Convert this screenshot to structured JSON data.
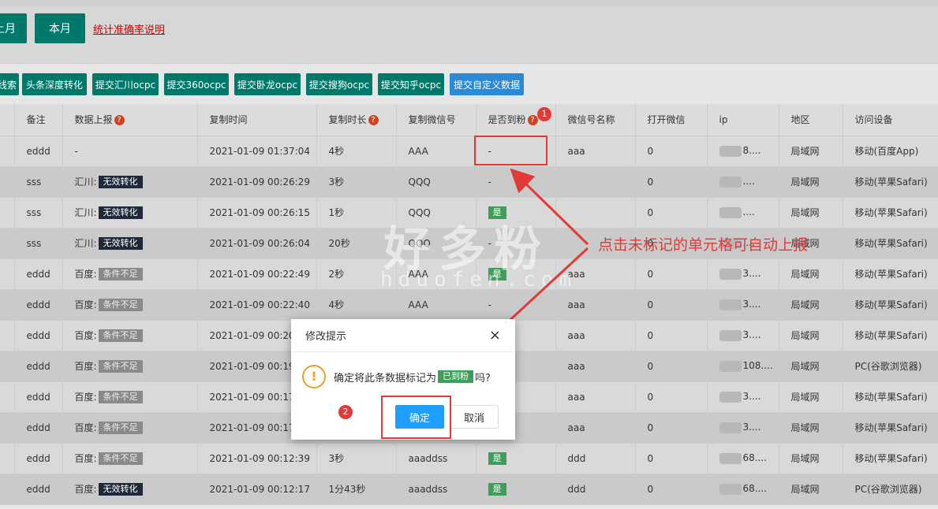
{
  "top": {
    "buttons": [
      "上月",
      "本月"
    ],
    "link": "统计准确率说明"
  },
  "toolbar": {
    "buttons": [
      "线索",
      "头条深度转化",
      "提交汇川ocpc",
      "提交360ocpc",
      "提交卧龙ocpc",
      "提交搜狗ocpc",
      "提交知乎ocpc",
      "提交自定义数据"
    ]
  },
  "table": {
    "columns": [
      "备注",
      "数据上报",
      "复制时间",
      "复制时长",
      "复制微信号",
      "是否到粉",
      "微信号名称",
      "打开微信",
      "ip",
      "地区",
      "访问设备"
    ],
    "help_mark": "?",
    "rows": [
      {
        "note": "eddd",
        "report_prefix": "-",
        "report_tag": "",
        "copy_time": "2021-01-09 01:37:04",
        "duration": "4秒",
        "wechat": "AAA",
        "fan": "-",
        "wx_name": "aaa",
        "open": "0",
        "ip": "8....",
        "region": "局域网",
        "device": "移动(百度App)"
      },
      {
        "note": "sss",
        "report_prefix": "汇川:",
        "report_tag": "无效转化",
        "copy_time": "2021-01-09 00:26:29",
        "duration": "3秒",
        "wechat": "QQQ",
        "fan": "-",
        "wx_name": "",
        "open": "0",
        "ip": "....",
        "region": "局域网",
        "device": "移动(苹果Safari)"
      },
      {
        "note": "sss",
        "report_prefix": "汇川:",
        "report_tag": "无效转化",
        "copy_time": "2021-01-09 00:26:15",
        "duration": "1秒",
        "wechat": "QQQ",
        "fan": "是",
        "wx_name": "",
        "open": "0",
        "ip": "....",
        "region": "局域网",
        "device": "移动(苹果Safari)"
      },
      {
        "note": "sss",
        "report_prefix": "汇川:",
        "report_tag": "无效转化",
        "copy_time": "2021-01-09 00:26:04",
        "duration": "20秒",
        "wechat": "QQQ",
        "fan": "-",
        "wx_name": "",
        "open": "0",
        "ip": "....",
        "region": "局域网",
        "device": "移动(苹果Safari)"
      },
      {
        "note": "eddd",
        "report_prefix": "百度:",
        "report_tag": "条件不足",
        "copy_time": "2021-01-09 00:22:49",
        "duration": "2秒",
        "wechat": "AAA",
        "fan": "是",
        "wx_name": "aaa",
        "open": "0",
        "ip": "3....",
        "region": "局域网",
        "device": "移动(苹果Safari)"
      },
      {
        "note": "eddd",
        "report_prefix": "百度:",
        "report_tag": "条件不足",
        "copy_time": "2021-01-09 00:22:40",
        "duration": "4秒",
        "wechat": "AAA",
        "fan": "-",
        "wx_name": "aaa",
        "open": "0",
        "ip": "3....",
        "region": "局域网",
        "device": "移动(苹果Safari)"
      },
      {
        "note": "eddd",
        "report_prefix": "百度:",
        "report_tag": "条件不足",
        "copy_time": "2021-01-09 00:20:2",
        "duration": "",
        "wechat": "",
        "fan": "",
        "wx_name": "aaa",
        "open": "0",
        "ip": "3....",
        "region": "局域网",
        "device": "移动(苹果Safari)"
      },
      {
        "note": "eddd",
        "report_prefix": "百度:",
        "report_tag": "条件不足",
        "copy_time": "2021-01-09 00:19:5",
        "duration": "",
        "wechat": "",
        "fan": "",
        "wx_name": "aaa",
        "open": "0",
        "ip": "108....",
        "region": "局域网",
        "device": "PC(谷歌浏览器)"
      },
      {
        "note": "eddd",
        "report_prefix": "百度:",
        "report_tag": "条件不足",
        "copy_time": "2021-01-09 00:17:1",
        "duration": "",
        "wechat": "",
        "fan": "",
        "wx_name": "aaa",
        "open": "0",
        "ip": "3....",
        "region": "局域网",
        "device": "移动(苹果Safari)"
      },
      {
        "note": "eddd",
        "report_prefix": "百度:",
        "report_tag": "条件不足",
        "copy_time": "2021-01-09 00:17:0",
        "duration": "",
        "wechat": "",
        "fan": "",
        "wx_name": "aaa",
        "open": "0",
        "ip": "3....",
        "region": "局域网",
        "device": "移动(苹果Safari)"
      },
      {
        "note": "eddd",
        "report_prefix": "百度:",
        "report_tag": "条件不足",
        "copy_time": "2021-01-09 00:12:39",
        "duration": "3秒",
        "wechat": "aaaddss",
        "fan": "是",
        "wx_name": "ddd",
        "open": "0",
        "ip": "68....",
        "region": "局域网",
        "device": "移动(苹果Safari)"
      },
      {
        "note": "eddd",
        "report_prefix": "百度:",
        "report_tag": "无效转化",
        "copy_time": "2021-01-09 00:12:17",
        "duration": "1分43秒",
        "wechat": "aaaddss",
        "fan": "是",
        "wx_name": "ddd",
        "open": "0",
        "ip": "68....",
        "region": "局域网",
        "device": "PC(谷歌浏览器)"
      }
    ]
  },
  "annotation": {
    "text": "点击未标记的单元格可自动上报",
    "badge1": "1",
    "badge2": "2",
    "color": "#e23a36"
  },
  "watermark": {
    "line1": "好多粉",
    "line2": "hduofen.com"
  },
  "dialog": {
    "title": "修改提示",
    "message_prefix": "确定将此条数据标记为",
    "message_tag": "已到粉",
    "message_suffix": "吗?",
    "ok": "确定",
    "cancel": "取消",
    "close": "×",
    "warn": "!"
  }
}
